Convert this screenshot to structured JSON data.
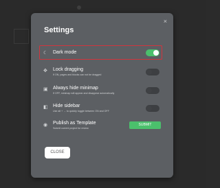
{
  "modal": {
    "title": "Settings",
    "close_icon": "×",
    "close_button_label": "CLOSE"
  },
  "settings": [
    {
      "icon": "moon-icon",
      "glyph": "☾",
      "label": "Dark mode",
      "description": "",
      "toggle": "on"
    },
    {
      "icon": "lock-drag-icon",
      "glyph": "✥",
      "label": "Lock dragging",
      "description": "If ON, pages and blocks can not be dragged",
      "toggle": "off"
    },
    {
      "icon": "minimap-icon",
      "glyph": "▣",
      "label": "Always hide minimap",
      "description": "If OFF, minimap will appear and disappear automatically",
      "toggle": "off"
    },
    {
      "icon": "sidebar-icon",
      "glyph": "◧",
      "label": "Hide sidebar",
      "description": "Use  alt  +  →  to quickly toggle between ON and OFF",
      "toggle": "off"
    },
    {
      "icon": "eye-icon",
      "glyph": "◉",
      "label": "Publish as Template",
      "description": "Submit current project for review",
      "button": "SUBMIT"
    }
  ],
  "colors": {
    "accent_green": "#4bc06c",
    "highlight_red": "#d2343d",
    "modal_bg": "#5c5f63"
  }
}
